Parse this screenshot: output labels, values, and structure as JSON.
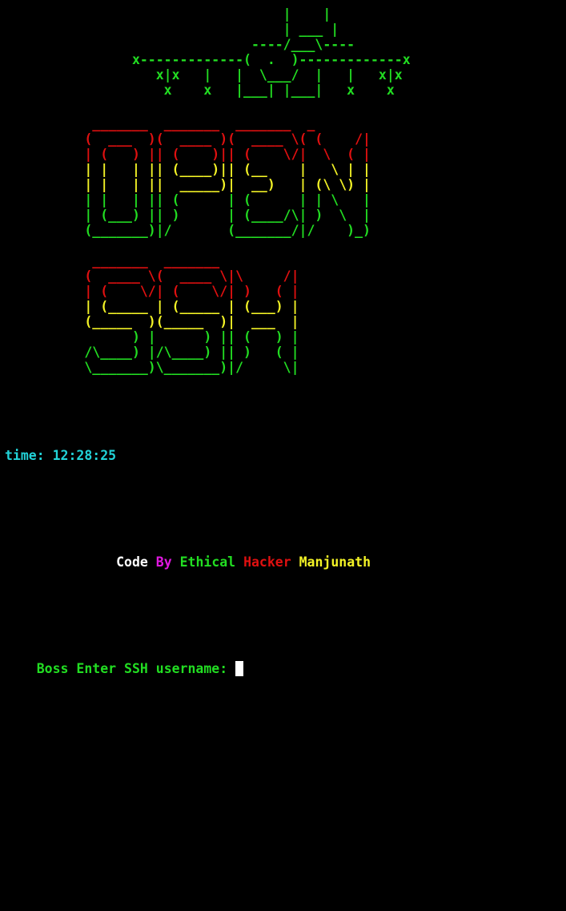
{
  "colors": {
    "background": "#000000",
    "green": "#22dd22",
    "red": "#e01010",
    "yellow": "#f3f326",
    "cyan": "#22d3d8",
    "magenta": "#e018e0",
    "white": "#ffffff",
    "cursor": "#ffffff"
  },
  "banner": {
    "logo_lines": [
      "                                   |    |",
      "                                   | ___ |",
      "                               ----/___\\----",
      "                x-------------(  .  )-------------x",
      "                   x|x   |   |  \\___/  |   |   x|x",
      "                    x    x   |___| |___|   x    x"
    ],
    "logo_color": "#22dd22",
    "open_lines": [
      {
        "text": "           _______  _______  _______  _",
        "color": "#e01010"
      },
      {
        "text": "          (  ___  )(  ____ )(  ____ \\( (    /|",
        "color": "#e01010"
      },
      {
        "text": "          | (   ) || (    )|| (    \\/|  \\  ( |",
        "color": "#e01010"
      },
      {
        "text": "          | |   | || (____)|| (__    |   \\ | |",
        "color": "#f3f326"
      },
      {
        "text": "          | |   | ||  _____)|  __)   | (\\ \\) |",
        "color": "#f3f326"
      },
      {
        "text": "          | |   | || (      | (      | | \\   |",
        "color": "#22dd22"
      },
      {
        "text": "          | (___) || )      | (____/\\| )  \\  |",
        "color": "#22dd22"
      },
      {
        "text": "          (_______)|/       (_______/|/    )_)",
        "color": "#22dd22"
      }
    ],
    "ssh_lines": [
      {
        "text": "           _______  _______",
        "color": "#e01010"
      },
      {
        "text": "          (  ____ \\(  ____ \\|\\     /|",
        "color": "#e01010"
      },
      {
        "text": "          | (    \\/| (    \\/| )   ( |",
        "color": "#e01010"
      },
      {
        "text": "          | (_____ | (_____ | (___) |",
        "color": "#f3f326"
      },
      {
        "text": "          (_____  )(_____  )|  ___  |",
        "color": "#f3f326"
      },
      {
        "text": "                ) |      ) || (   ) |",
        "color": "#22dd22"
      },
      {
        "text": "          /\\____) |/\\____) || )   ( |",
        "color": "#22dd22"
      },
      {
        "text": "          \\_______)\\_______)|/     \\|",
        "color": "#22dd22"
      }
    ]
  },
  "time": {
    "label": "time: 12:28:25",
    "color": "#22d3d8"
  },
  "credit": {
    "indent": "          ",
    "parts": [
      {
        "text": "Code ",
        "color": "#ffffff"
      },
      {
        "text": "By ",
        "color": "#e018e0"
      },
      {
        "text": "Ethical ",
        "color": "#22dd22"
      },
      {
        "text": "Hacker ",
        "color": "#e01010"
      },
      {
        "text": "Manjunath",
        "color": "#f3f326"
      }
    ]
  },
  "prompt": {
    "label": "Boss Enter SSH username: ",
    "value": "",
    "color": "#22dd22"
  }
}
